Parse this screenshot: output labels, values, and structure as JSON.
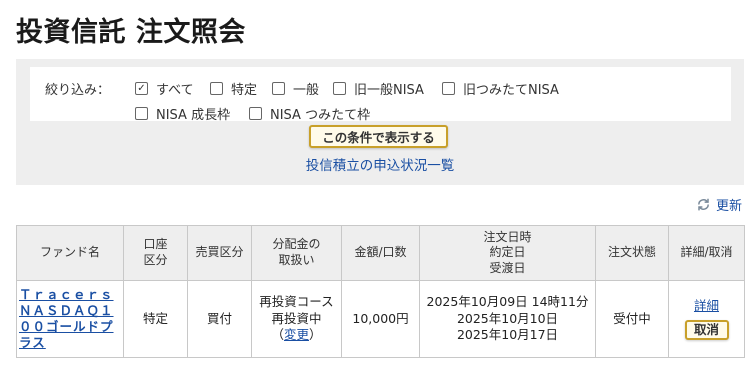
{
  "page": {
    "title": "投資信託 注文照会"
  },
  "filter": {
    "label": "絞り込み：",
    "options": [
      {
        "label": "すべて",
        "checked": true
      },
      {
        "label": "特定",
        "checked": false
      },
      {
        "label": "一般",
        "checked": false
      },
      {
        "label": "旧一般NISA",
        "checked": false
      },
      {
        "label": "旧つみたてNISA",
        "checked": false
      },
      {
        "label": "NISA 成長枠",
        "checked": false
      },
      {
        "label": "NISA つみたて枠",
        "checked": false
      }
    ],
    "check_mark": "✓",
    "search_button": "この条件で表示する",
    "sub_link": "投信積立の申込状況一覧"
  },
  "refresh": {
    "label": "更新",
    "icon": "refresh-icon"
  },
  "table": {
    "headers": {
      "fund": "ファンド名",
      "account_1": "口座",
      "account_2": "区分",
      "trade": "売買区分",
      "dist_1": "分配金の",
      "dist_2": "取扱い",
      "amount": "金額/口数",
      "dates_1": "注文日時",
      "dates_2": "約定日",
      "dates_3": "受渡日",
      "status": "注文状態",
      "action": "詳細/取消"
    },
    "rows": [
      {
        "fund_name": "Ｔｒａｃｅｒｓ ＮＡＳＤＡＱ１００ゴールドプラス",
        "account": "特定",
        "trade": "買付",
        "dist_1": "再投資コース",
        "dist_2": "再投資中",
        "dist_change_open": "（",
        "dist_change": "変更",
        "dist_change_close": "）",
        "amount": "10,000円",
        "order_datetime": "2025年10月09日 14時11分",
        "contract_date": "2025年10月10日",
        "delivery_date": "2025年10月17日",
        "status": "受付中",
        "detail": "詳細",
        "cancel": "取消"
      }
    ]
  },
  "colors": {
    "accent_link": "#1a4fa3",
    "buy_red": "#c0282e",
    "button_border": "#c8a02a",
    "panel_bg": "#eeeeee"
  }
}
